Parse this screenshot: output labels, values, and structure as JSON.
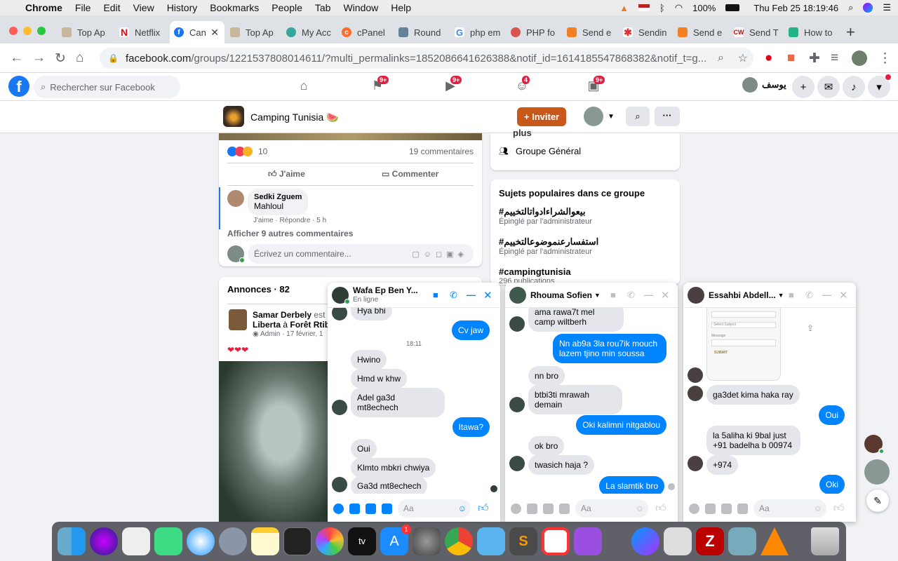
{
  "menubar": {
    "app": "Chrome",
    "items": [
      "File",
      "Edit",
      "View",
      "History",
      "Bookmarks",
      "People",
      "Tab",
      "Window",
      "Help"
    ],
    "battery": "100%",
    "datetime": "Thu Feb 25  18:19:46"
  },
  "tabs": [
    {
      "label": "Top Ap"
    },
    {
      "label": "Netflix"
    },
    {
      "label": "Can"
    },
    {
      "label": "Top Ap"
    },
    {
      "label": "My Acc"
    },
    {
      "label": "cPanel"
    },
    {
      "label": "Round"
    },
    {
      "label": "php em"
    },
    {
      "label": "PHP fo"
    },
    {
      "label": "Send e"
    },
    {
      "label": "Sendin"
    },
    {
      "label": "Send e"
    },
    {
      "label": "Send T"
    },
    {
      "label": "How to"
    }
  ],
  "address": {
    "domain": "facebook.com",
    "path": "/groups/1221537808014611/?multi_permalinks=1852086641626388&notif_id=1614185547868382&notif_t=g..."
  },
  "fb": {
    "search_placeholder": "Rechercher sur Facebook",
    "badges": {
      "pages": "9+",
      "watch": "9+",
      "groups": "4",
      "gaming": "9+"
    },
    "user_name": "يوسف"
  },
  "group": {
    "name": "Camping Tunisia 🍉",
    "invite_label": "+ Inviter"
  },
  "post": {
    "reaction_count": "10",
    "comments_count": "19 commentaires",
    "like_label": "J'aime",
    "comment_label": "Commenter",
    "comment": {
      "author": "Sedki Zguem",
      "text": "Mahloul",
      "actions": "J'aime · Répondre · 5 h"
    },
    "more_comments": "Afficher 9 autres commentaires",
    "write_placeholder": "Écrivez un commentaire..."
  },
  "announcements": {
    "title": "Annonces · 82",
    "author": "Samar Derbely",
    "suffix": "est a",
    "line2a": "Liberta",
    "line2b": "à",
    "line2c": "Forêt Rtib",
    "meta": "Admin · 17 février, 1",
    "hearts": "❤❤❤"
  },
  "sidebar": {
    "cut_text": "plus",
    "general": "Groupe Général",
    "popular_title": "Sujets populaires dans ce groupe",
    "topics": [
      {
        "tag": "#بيعوالشراءادواتالتخييم",
        "sub": "Épinglé par l'administrateur"
      },
      {
        "tag": "#استفسارعنموضوعالتخييم",
        "sub": "Épinglé par l'administrateur"
      },
      {
        "tag": "#campingtunisia",
        "sub": "296 publications"
      }
    ]
  },
  "chats": [
    {
      "name": "Wafa Ep Ben Y...",
      "status": "En ligne",
      "top_cut": "Hya bhi",
      "input_placeholder": "Aa",
      "messages": [
        {
          "dir": "out",
          "text": "Cv jaw"
        },
        {
          "dir": "time",
          "text": "18:11"
        },
        {
          "dir": "in",
          "text": "Hwino"
        },
        {
          "dir": "in",
          "text": "Hmd w khw"
        },
        {
          "dir": "in",
          "text": "Adel ga3d mt8echech"
        },
        {
          "dir": "out",
          "text": "Itawa?"
        },
        {
          "dir": "in",
          "text": "Oui"
        },
        {
          "dir": "in",
          "text": "Klmto mbkri chwiya"
        },
        {
          "dir": "in",
          "text": "Ga3d mt8echech"
        }
      ]
    },
    {
      "name": "Rhouma Sofien",
      "input_placeholder": "Aa",
      "messages": [
        {
          "dir": "in",
          "text": "ama rawa7t mel camp wiltberh"
        },
        {
          "dir": "out",
          "text": "Nn ab9a 3la rou7ik mouch lazem tjino min soussa"
        },
        {
          "dir": "in",
          "text": "nn bro"
        },
        {
          "dir": "in",
          "text": "btbi3ti mrawah demain"
        },
        {
          "dir": "out",
          "text": "Oki kalimni nitgablou"
        },
        {
          "dir": "in",
          "text": "ok bro"
        },
        {
          "dir": "in",
          "text": "twasich haja ?"
        },
        {
          "dir": "out",
          "text": "La slamtik bro"
        }
      ]
    },
    {
      "name": "Essahbi Abdell...",
      "input_placeholder": "Aa",
      "form_labels": [
        "Select Subject",
        "Message",
        "SUBMIT"
      ],
      "messages": [
        {
          "dir": "in",
          "text": "ga3det kima haka ray"
        },
        {
          "dir": "out",
          "text": "Oui"
        },
        {
          "dir": "in",
          "text": "la 5aliha ki 9bal just +91 badelha b 00974"
        },
        {
          "dir": "in",
          "text": "+974"
        },
        {
          "dir": "out",
          "text": "Oki"
        }
      ]
    }
  ],
  "colors": {
    "fb_blue": "#1877f2",
    "messenger_blue": "#0084ff",
    "invite_orange": "#c8571a",
    "badge_red": "#e41e3f"
  }
}
